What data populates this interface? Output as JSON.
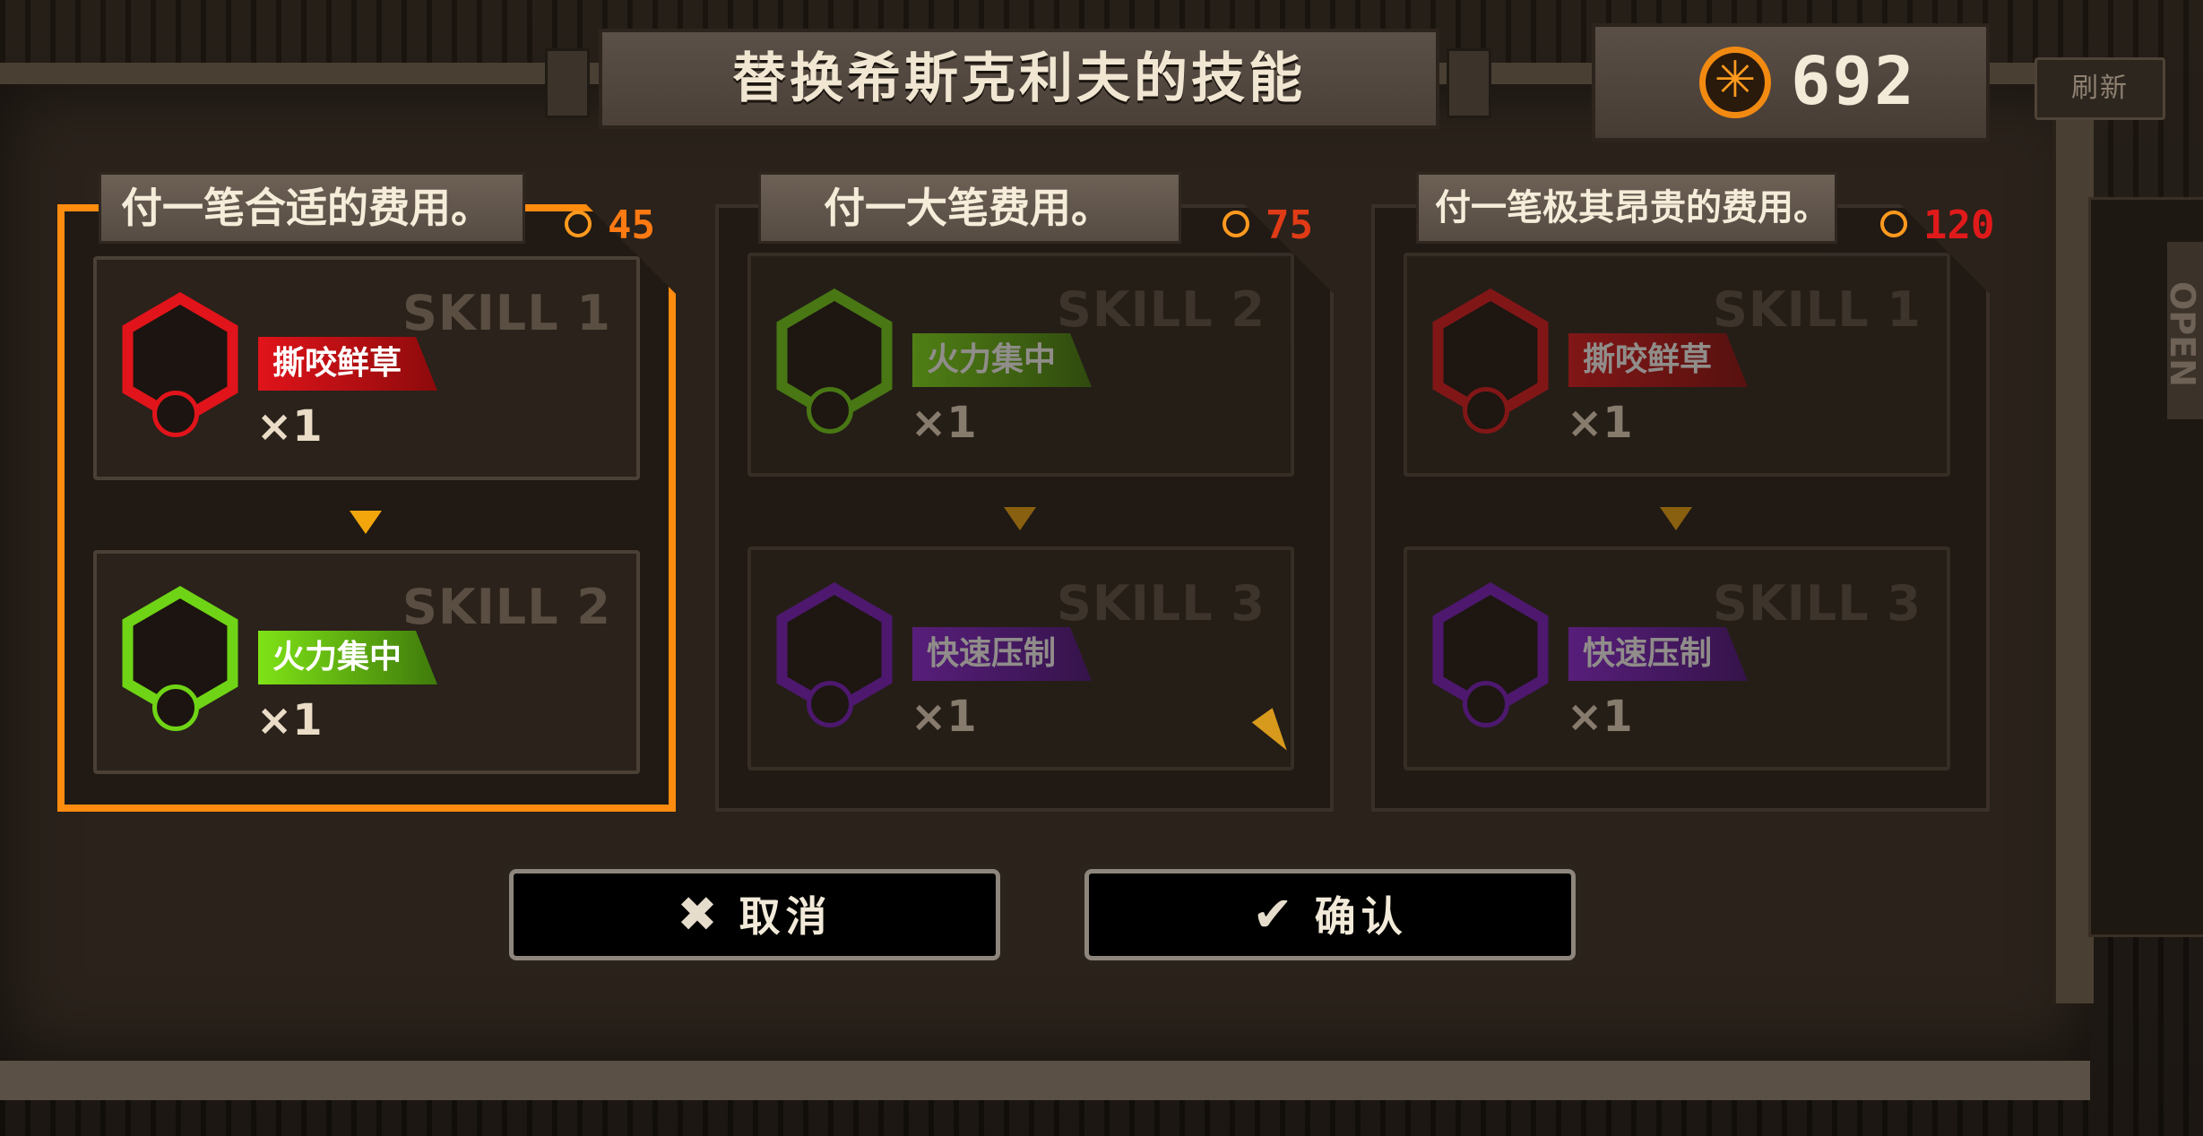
{
  "header": {
    "title": "替换希斯克利夫的技能",
    "currency_value": "692",
    "currency_icon": "sun-coin-icon",
    "refresh_label": "刷新"
  },
  "side_panel": {
    "letters": "OPEN"
  },
  "options": [
    {
      "label": "付一笔合适的费用。",
      "cost": "45",
      "cost_color": "#ff7a12",
      "selected": true,
      "from": {
        "tag": "SKILL 1",
        "name": "撕咬鲜草",
        "count": "×1",
        "color": "#e0141a"
      },
      "to": {
        "tag": "SKILL 2",
        "name": "火力集中",
        "count": "×1",
        "color": "#6fd415"
      }
    },
    {
      "label": "付一大笔费用。",
      "cost": "75",
      "cost_color": "#e03b16",
      "selected": false,
      "from": {
        "tag": "SKILL 2",
        "name": "火力集中",
        "count": "×1",
        "color": "#6fd415"
      },
      "to": {
        "tag": "SKILL 3",
        "name": "快速压制",
        "count": "×1",
        "color": "#7a18c8"
      }
    },
    {
      "label": "付一笔极其昂贵的费用。",
      "cost": "120",
      "cost_color": "#e01a1a",
      "selected": false,
      "from": {
        "tag": "SKILL 1",
        "name": "撕咬鲜草",
        "count": "×1",
        "color": "#e0141a"
      },
      "to": {
        "tag": "SKILL 3",
        "name": "快速压制",
        "count": "×1",
        "color": "#7a18c8"
      }
    }
  ],
  "buttons": {
    "cancel_label": "取消",
    "confirm_label": "确认"
  }
}
